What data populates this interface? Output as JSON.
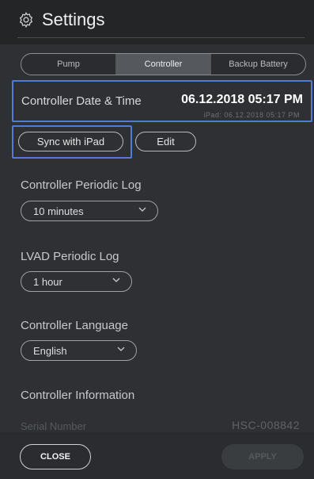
{
  "header": {
    "title": "Settings",
    "icon": "gear-icon"
  },
  "tabs": [
    {
      "label": "Pump",
      "active": false
    },
    {
      "label": "Controller",
      "active": true
    },
    {
      "label": "Backup Battery",
      "active": false
    }
  ],
  "datetime": {
    "label": "Controller Date & Time",
    "value": "06.12.2018 05:17 PM",
    "ipad_text": "iPad: 06.12.2018 05:17 PM"
  },
  "actions": {
    "sync_label": "Sync with iPad",
    "edit_label": "Edit"
  },
  "periodic_log": {
    "label": "Controller Periodic Log",
    "value": "10 minutes"
  },
  "lvad_log": {
    "label": "LVAD Periodic Log",
    "value": "1 hour"
  },
  "language": {
    "label": "Controller Language",
    "value": "English"
  },
  "info": {
    "label": "Controller Information",
    "serial_label": "Serial Number",
    "serial_value": "HSC-008842"
  },
  "footer": {
    "close_label": "CLOSE",
    "apply_label": "APPLY"
  },
  "colors": {
    "highlight": "#4f7dd3",
    "background": "#2e3033",
    "header": "#232527"
  }
}
